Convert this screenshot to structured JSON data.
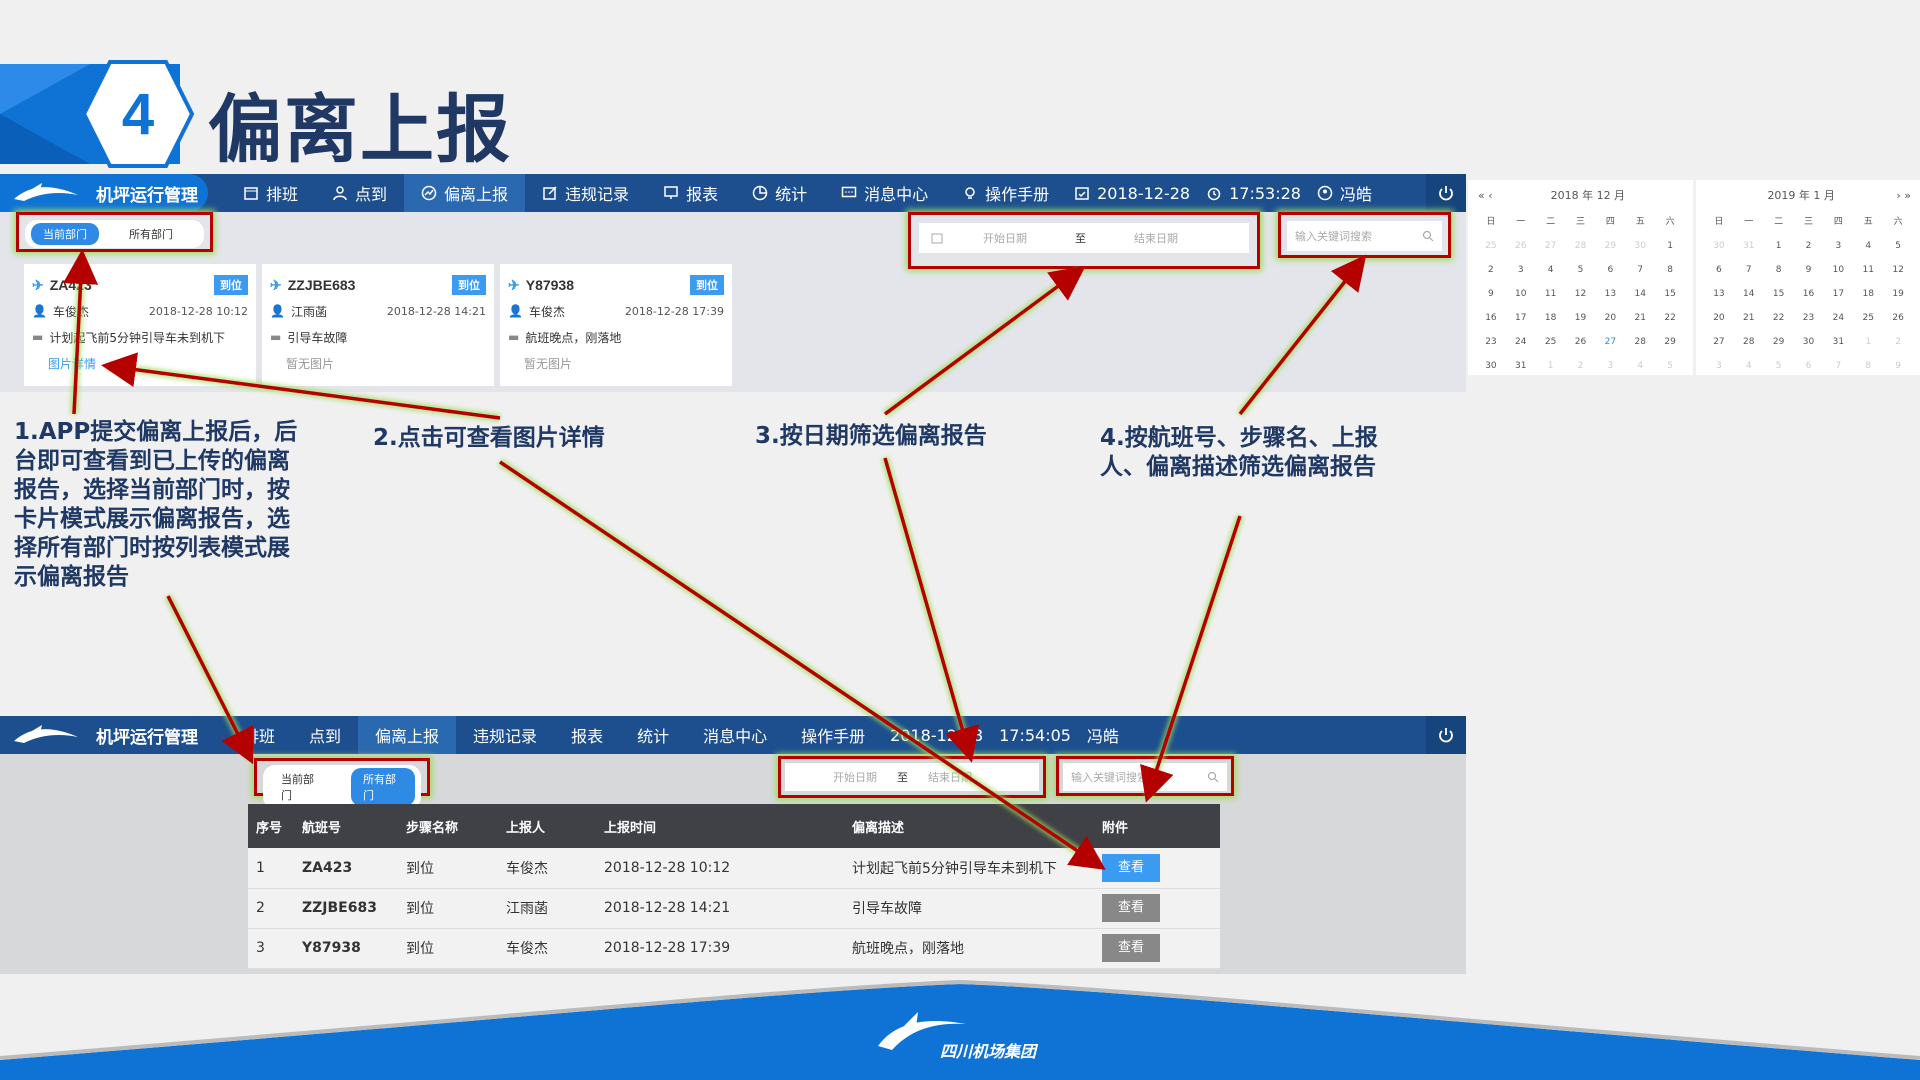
{
  "slide": {
    "number": "4",
    "title": "偏离上报",
    "footer_brand": "四川机场集团"
  },
  "nav": {
    "brand": "机坪运行管理",
    "items": [
      {
        "label": "排班",
        "icon": "calendar-icon"
      },
      {
        "label": "点到",
        "icon": "user-icon"
      },
      {
        "label": "偏离上报",
        "icon": "chart-icon"
      },
      {
        "label": "违规记录",
        "icon": "edit-icon"
      },
      {
        "label": "报表",
        "icon": "report-icon"
      },
      {
        "label": "统计",
        "icon": "pie-icon"
      },
      {
        "label": "消息中心",
        "icon": "message-icon"
      },
      {
        "label": "操作手册",
        "icon": "bulb-icon"
      }
    ],
    "date": "2018-12-28",
    "time_top": "17:53:28",
    "time_bottom": "17:54:05",
    "user": "冯皓"
  },
  "filters": {
    "current_dept": "当前部门",
    "all_dept": "所有部门",
    "start_date": "开始日期",
    "to": "至",
    "end_date": "结束日期",
    "search_placeholder": "输入关键词搜索"
  },
  "cards": [
    {
      "flight": "ZA423",
      "status": "到位",
      "person": "车俊杰",
      "time": "2018-12-28 10:12",
      "desc": "计划起飞前5分钟引导车未到机下",
      "image": "图片详情"
    },
    {
      "flight": "ZZJBE683",
      "status": "到位",
      "person": "江雨菡",
      "time": "2018-12-28 14:21",
      "desc": "引导车故障",
      "image": "暂无图片"
    },
    {
      "flight": "Y87938",
      "status": "到位",
      "person": "车俊杰",
      "time": "2018-12-28 17:39",
      "desc": "航班晚点，刚落地",
      "image": "暂无图片"
    }
  ],
  "annotations": {
    "a1": "1.APP提交偏离上报后，后台即可查看到已上传的偏离报告，选择当前部门时，按卡片模式展示偏离报告，选择所有部门时按列表模式展示偏离报告",
    "a2": "2.点击可查看图片详情",
    "a3": "3.按日期筛选偏离报告",
    "a4": "4.按航班号、步骤名、上报人、偏离描述筛选偏离报告"
  },
  "calendar": {
    "left_title": "2018 年 12 月",
    "right_title": "2019 年 1 月",
    "weekdays": [
      "日",
      "一",
      "二",
      "三",
      "四",
      "五",
      "六"
    ],
    "left_days": [
      "25",
      "26",
      "27",
      "28",
      "29",
      "30",
      "1",
      "2",
      "3",
      "4",
      "5",
      "6",
      "7",
      "8",
      "9",
      "10",
      "11",
      "12",
      "13",
      "14",
      "15",
      "16",
      "17",
      "18",
      "19",
      "20",
      "21",
      "22",
      "23",
      "24",
      "25",
      "26",
      "27",
      "28",
      "29",
      "30",
      "31",
      "1",
      "2",
      "3",
      "4",
      "5"
    ],
    "right_days": [
      "30",
      "31",
      "1",
      "2",
      "3",
      "4",
      "5",
      "6",
      "7",
      "8",
      "9",
      "10",
      "11",
      "12",
      "13",
      "14",
      "15",
      "16",
      "17",
      "18",
      "19",
      "20",
      "21",
      "22",
      "23",
      "24",
      "25",
      "26",
      "27",
      "28",
      "29",
      "30",
      "31",
      "1",
      "2",
      "3",
      "4",
      "5",
      "6",
      "7",
      "8",
      "9"
    ]
  },
  "table": {
    "headers": [
      "序号",
      "航班号",
      "步骤名称",
      "上报人",
      "上报时间",
      "偏离描述",
      "附件"
    ],
    "rows": [
      [
        "1",
        "ZA423",
        "到位",
        "车俊杰",
        "2018-12-28 10:12",
        "计划起飞前5分钟引导车未到机下",
        "查看"
      ],
      [
        "2",
        "ZZJBE683",
        "到位",
        "江雨菡",
        "2018-12-28 14:21",
        "引导车故障",
        "查看"
      ],
      [
        "3",
        "Y87938",
        "到位",
        "车俊杰",
        "2018-12-28 17:39",
        "航班晚点，刚落地",
        "查看"
      ]
    ]
  },
  "colors": {
    "accent": "#0f73d6",
    "nav": "#1d4f8f",
    "annotation": "#1f3864",
    "highlight": "#b50000"
  }
}
